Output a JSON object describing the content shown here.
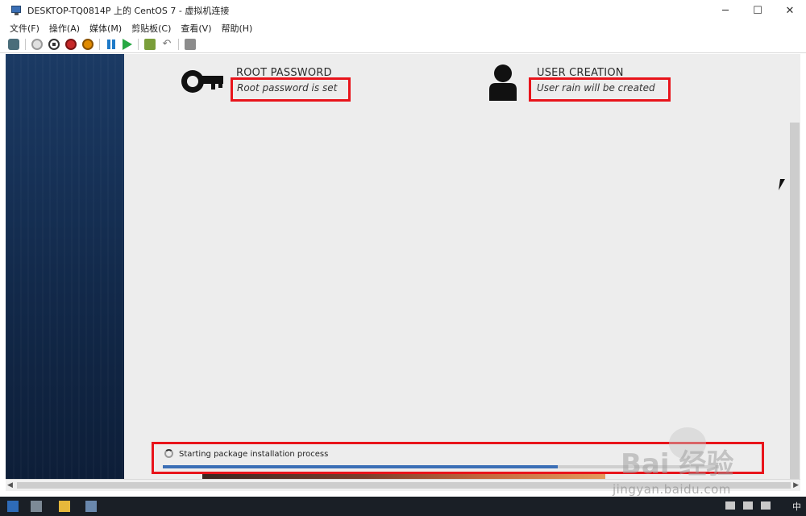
{
  "window": {
    "title": "DESKTOP-TQ0814P 上的 CentOS 7 - 虚拟机连接",
    "minimize": "─",
    "maximize": "☐",
    "close": "✕"
  },
  "menu": [
    "文件(F)",
    "操作(A)",
    "媒体(M)",
    "剪贴板(C)",
    "查看(V)",
    "帮助(H)"
  ],
  "toolbar_icons": [
    "ctrl-alt-del-icon",
    "start-icon",
    "turn-off-icon",
    "shutdown-icon",
    "save-icon",
    "pause-icon",
    "reset-icon",
    "checkpoint-icon",
    "revert-icon",
    "enhanced-session-icon"
  ],
  "installer": {
    "root_password": {
      "title": "ROOT PASSWORD",
      "status": "Root password is set",
      "icon": "key-icon"
    },
    "user_creation": {
      "title": "USER CREATION",
      "status": "User rain will be created",
      "icon": "user-icon"
    },
    "progress": {
      "label": "Starting package installation process",
      "fraction": 0.71
    }
  },
  "watermark": {
    "logo": "Bai 经验",
    "url": "jingyan.baidu.com"
  },
  "taskbar": {
    "ime": "中"
  },
  "colors": {
    "highlight": "#e8141b",
    "progress_fill": "#3b6fb6",
    "sidebar": "#12294a",
    "content_bg": "#ededed"
  }
}
